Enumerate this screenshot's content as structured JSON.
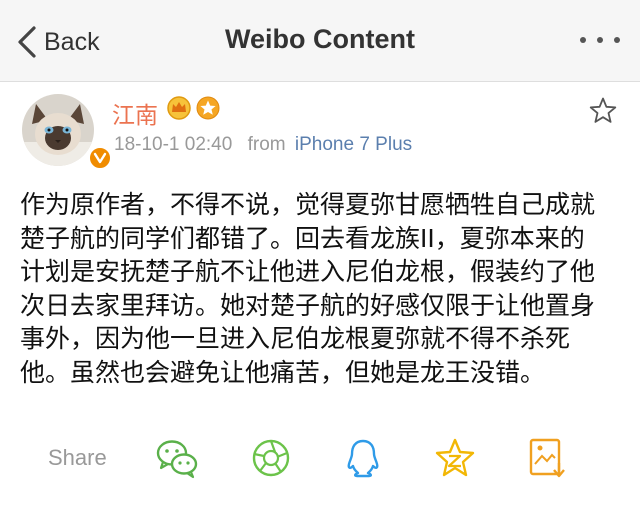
{
  "nav": {
    "back_label": "Back",
    "title": "Weibo Content"
  },
  "post": {
    "author": "江南",
    "timestamp": "18-10-1 02:40",
    "from_label": "from",
    "source": "iPhone 7 Plus",
    "lines": [
      "作为原作者，不得不说，觉得夏弥甘愿牺牲自己成就",
      "楚子航的同学们都错了。回去看龙族II，夏弥本来的",
      "计划是安抚楚子航不让他进入尼伯龙根，假装约了他",
      "次日去家里拜访。她对楚子航的好感仅限于让他置身",
      "事外，因为他一旦进入尼伯龙根夏弥就不得不杀死",
      "他。虽然也会避免让他痛苦，但她是龙王没错。"
    ]
  },
  "share": {
    "label": "Share",
    "targets": [
      "wechat-icon",
      "moments-icon",
      "qq-icon",
      "qzone-icon",
      "save-image-icon"
    ]
  },
  "colors": {
    "author": "#eb7350",
    "source_link": "#5b7fae",
    "wechat": "#5ab04a",
    "moments": "#6cc34a",
    "qq": "#2f9be8",
    "qzone": "#f2b705",
    "save_image": "#f0a020"
  }
}
